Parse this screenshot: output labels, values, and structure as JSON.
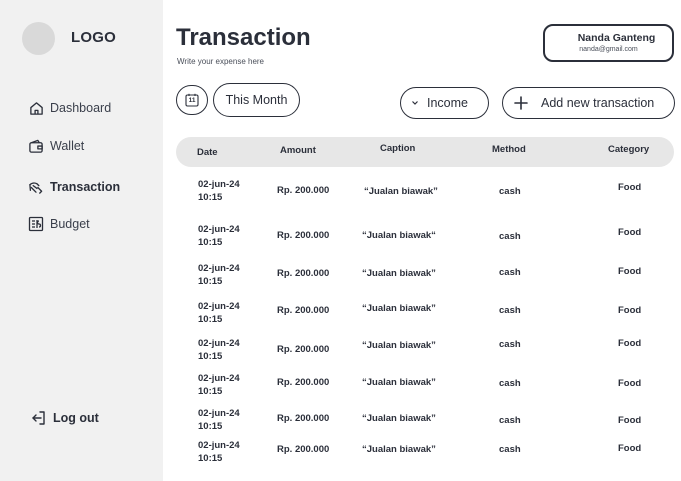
{
  "sidebar": {
    "logo": "LOGO",
    "nav": [
      {
        "label": "Dashboard",
        "icon": "home-icon"
      },
      {
        "label": "Wallet",
        "icon": "wallet-icon"
      },
      {
        "label": "Transaction",
        "icon": "transaction-icon",
        "active": true
      },
      {
        "label": "Budget",
        "icon": "budget-icon"
      }
    ],
    "logout": "Log out"
  },
  "header": {
    "title": "Transaction",
    "subtitle": "Write your expense here",
    "user_name": "Nanda Ganteng",
    "user_email": "nanda@gmail.com"
  },
  "toolbar": {
    "calendar_day": "11",
    "period_label": "This Month",
    "filter_label": "Income",
    "add_label": "Add new transaction"
  },
  "table": {
    "columns": [
      "Date",
      "Amount",
      "Caption",
      "Method",
      "Category"
    ],
    "rows": [
      {
        "date_line1": "02-jun-24",
        "date_line2": "10:15",
        "amount": "Rp. 200.000",
        "caption": "“Jualan biawak”",
        "method": "cash",
        "category": "Food"
      },
      {
        "date_line1": "02-jun-24",
        "date_line2": "10:15",
        "amount": "Rp. 200.000",
        "caption": "“Jualan biawak“",
        "method": "cash",
        "category": "Food"
      },
      {
        "date_line1": "02-jun-24",
        "date_line2": "10:15",
        "amount": "Rp. 200.000",
        "caption": "“Jualan biawak”",
        "method": "cash",
        "category": "Food"
      },
      {
        "date_line1": "02-jun-24",
        "date_line2": "10:15",
        "amount": "Rp. 200.000",
        "caption": "“Jualan biawak”",
        "method": "cash",
        "category": "Food"
      },
      {
        "date_line1": "02-jun-24",
        "date_line2": "10:15",
        "amount": "Rp. 200.000",
        "caption": "“Jualan biawak”",
        "method": "cash",
        "category": "Food"
      },
      {
        "date_line1": "02-jun-24",
        "date_line2": "10:15",
        "amount": "Rp. 200.000",
        "caption": "“Jualan biawak”",
        "method": "cash",
        "category": "Food"
      },
      {
        "date_line1": "02-jun-24",
        "date_line2": "10:15",
        "amount": "Rp. 200.000",
        "caption": "“Jualan biawak”",
        "method": "cash",
        "category": "Food"
      },
      {
        "date_line1": "02-jun-24",
        "date_line2": "10:15",
        "amount": "Rp. 200.000",
        "caption": "“Jualan biawak”",
        "method": "cash",
        "category": "Food"
      }
    ]
  }
}
